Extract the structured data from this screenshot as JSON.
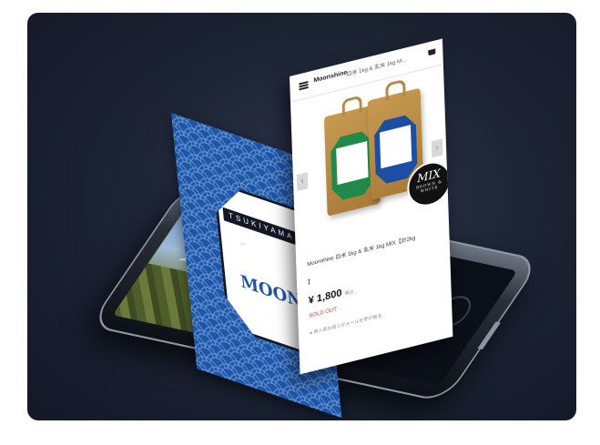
{
  "product_card": {
    "shop_name": "Moonshine",
    "breadcrumb": "白米 1kg & 玄米 1kg M...",
    "title": "Moonshine  白米 1kg & 玄米 1kg MIX【計2kg",
    "title_suffix": "】",
    "price": "¥ 1,800",
    "price_tax": "税込",
    "stock_status": "SOLD OUT",
    "note": "● 再入荷お知らせメールを受け取る"
  },
  "mix_badge": {
    "title": "MIX",
    "subtitle": "BROWN & WHITE"
  },
  "blue_card": {
    "brand": "TSUKIYAMA",
    "big_word": "MOON",
    "blurb": "...",
    "sub": ""
  },
  "colors": {
    "background": "#1b2232",
    "blue_card": "#1e56a8",
    "soldout": "#d33333"
  }
}
